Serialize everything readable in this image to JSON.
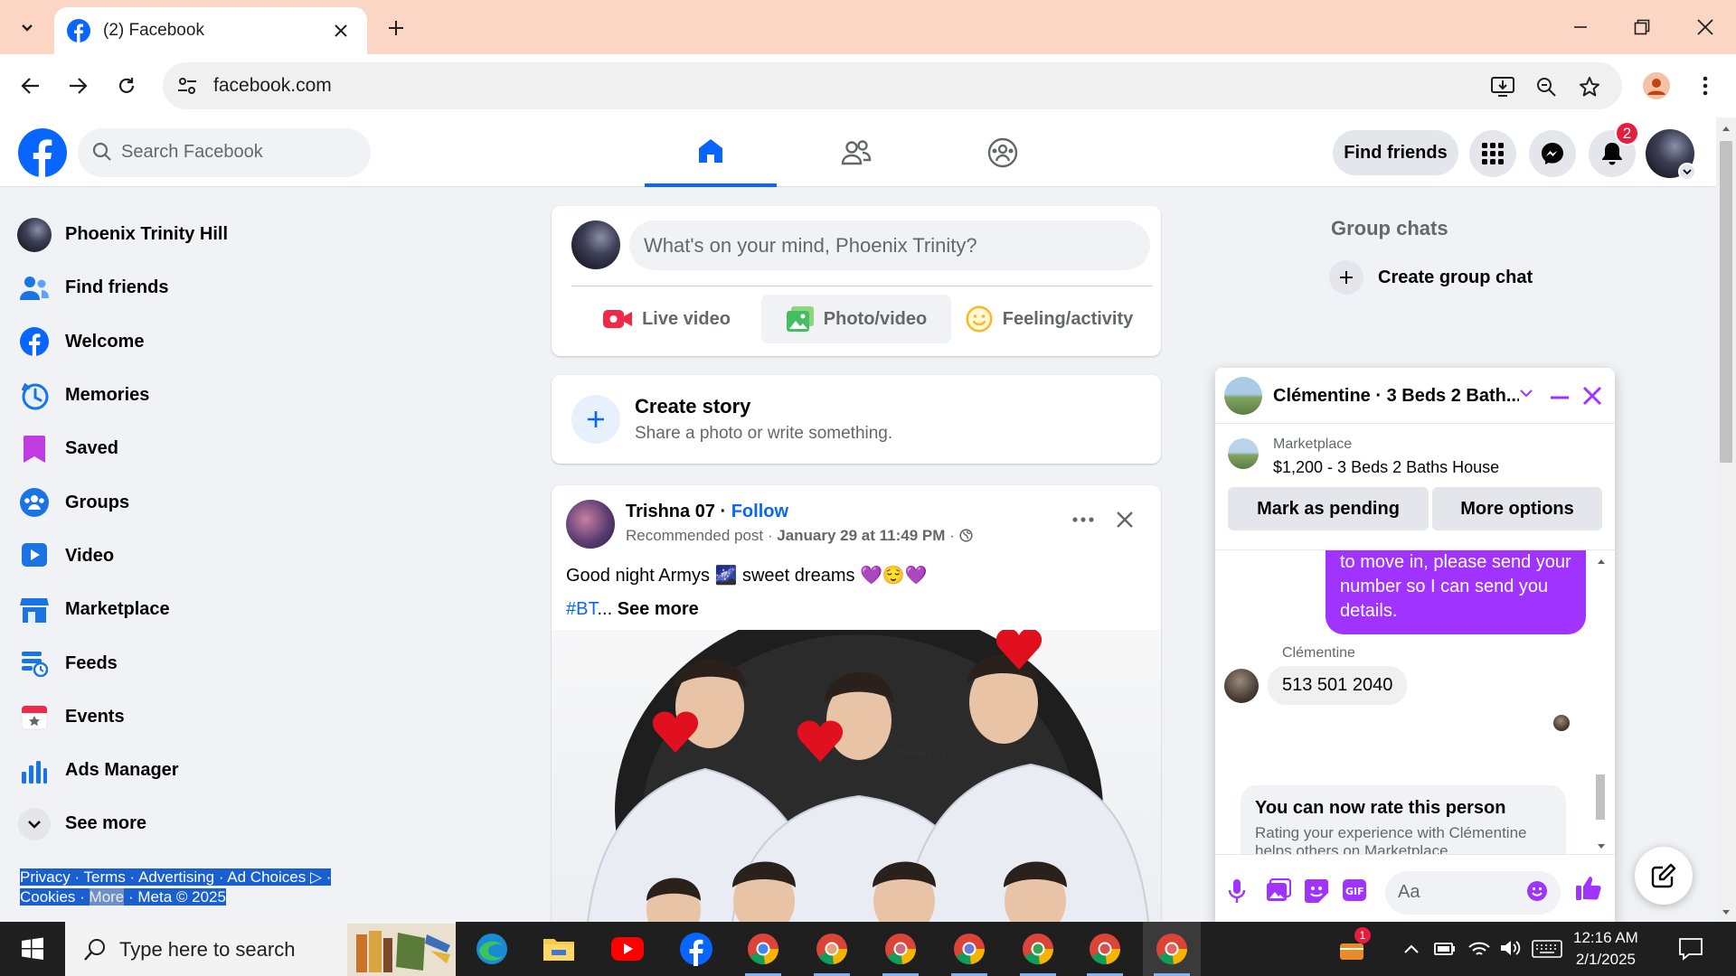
{
  "browser": {
    "tab_title": "(2) Facebook",
    "url": "facebook.com",
    "icons": [
      "tab-list-icon",
      "close-icon",
      "plus-icon",
      "minimize-icon",
      "restore-icon",
      "back-icon",
      "forward-icon",
      "reload-icon",
      "site-settings-icon",
      "install-icon",
      "zoom-icon",
      "star-icon",
      "profile-icon",
      "kebab-icon"
    ]
  },
  "fb_header": {
    "search_placeholder": "Search Facebook",
    "find_friends": "Find friends",
    "notification_count": "2",
    "accent_color": "#0866ff"
  },
  "sidebar": {
    "items": [
      {
        "label": "Phoenix Trinity Hill",
        "icon": "avatar"
      },
      {
        "label": "Find friends",
        "icon": "friends-icon"
      },
      {
        "label": "Welcome",
        "icon": "facebook-icon"
      },
      {
        "label": "Memories",
        "icon": "clock-icon"
      },
      {
        "label": "Saved",
        "icon": "bookmark-icon"
      },
      {
        "label": "Groups",
        "icon": "groups-icon"
      },
      {
        "label": "Video",
        "icon": "video-icon"
      },
      {
        "label": "Marketplace",
        "icon": "marketplace-icon"
      },
      {
        "label": "Feeds",
        "icon": "feeds-icon"
      },
      {
        "label": "Events",
        "icon": "calendar-icon"
      },
      {
        "label": "Ads Manager",
        "icon": "chart-icon"
      },
      {
        "label": "See more",
        "icon": "chevron-down-icon"
      }
    ],
    "footer": {
      "privacy": "Privacy",
      "terms": "Terms",
      "advertising": "Advertising",
      "ad_choices": "Ad Choices",
      "cookies": "Cookies",
      "more": "More",
      "meta": "Meta © 2025"
    }
  },
  "composer": {
    "placeholder": "What's on your mind, Phoenix Trinity?",
    "live_video": "Live video",
    "photo_video": "Photo/video",
    "feeling": "Feeling/activity"
  },
  "story": {
    "title": "Create story",
    "subtitle": "Share a photo or write something."
  },
  "post": {
    "author": "Trishna 07",
    "follow": "Follow",
    "meta_prefix": "Recommended post · ",
    "date": "January 29 at 11:49 PM",
    "meta_suffix": " ·",
    "text": "Good night Armys 🌌 sweet dreams 💜😌💜",
    "hashtag": "#BT",
    "ellipsis": "... ",
    "see_more": "See more",
    "image_watermark": "Trishna 07"
  },
  "right_rail": {
    "group_chats": "Group chats",
    "create_group_chat": "Create group chat"
  },
  "chat": {
    "title": "Clémentine · 3 Beds 2 Bath...",
    "marketplace_label": "Marketplace",
    "listing": "$1,200 - 3 Beds 2 Baths House",
    "mark_pending": "Mark as pending",
    "more_options": "More options",
    "outgoing_message": "to move in, please send your number so I can send you details.",
    "sender_name": "Clémentine",
    "incoming_message": "513 501 2040",
    "rate_title": "You can now rate this person",
    "rate_subtitle": "Rating your experience with Clémentine helps others on Marketplace",
    "input_placeholder": "Aa",
    "accent_color": "#a033ff"
  },
  "taskbar": {
    "search_placeholder": "Type here to search",
    "time": "12:16 AM",
    "date": "2/1/2025",
    "apps": [
      "edge-icon",
      "file-explorer-icon",
      "youtube-icon",
      "facebook-icon",
      "chrome-icon",
      "chrome-icon",
      "chrome-icon",
      "chrome-icon",
      "chrome-icon",
      "chrome-icon",
      "chrome-icon"
    ],
    "tray_badge": "1"
  }
}
